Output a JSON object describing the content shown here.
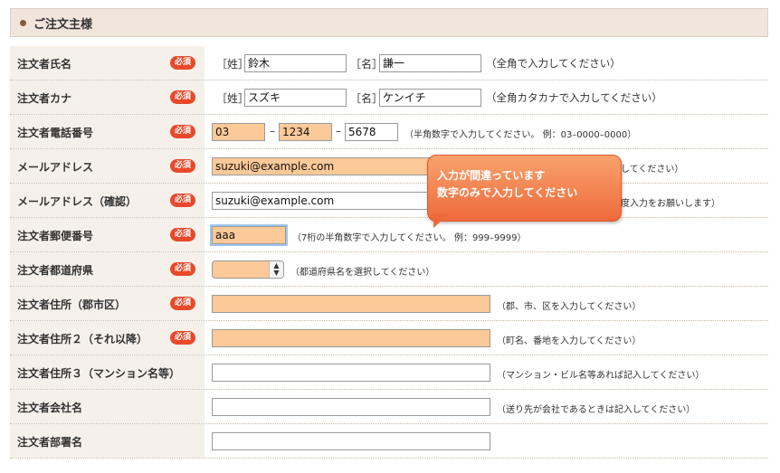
{
  "section": {
    "title": "ご注文主様"
  },
  "required_label": "必須",
  "error_tooltip": {
    "line1": "入力が間違っています",
    "line2": "数字のみで入力してください"
  },
  "rows": {
    "name": {
      "label": "注文者氏名",
      "sei_tag": "［姓］",
      "sei_value": "鈴木",
      "mei_tag": "［名］",
      "mei_value": "謙一",
      "hint": "（全角で入力してください）"
    },
    "kana": {
      "label": "注文者カナ",
      "sei_tag": "［姓］",
      "sei_value": "スズキ",
      "mei_tag": "［名］",
      "mei_value": "ケンイチ",
      "hint": "（全角カタカナで入力してください）"
    },
    "phone": {
      "label": "注文者電話番号",
      "part1": "03",
      "part2": "1234",
      "part3": "5678",
      "dash": "–",
      "hint": "（半角数字で入力してください。 例：03–0000–0000）"
    },
    "email": {
      "label": "メールアドレス",
      "value": "suzuki@example.com",
      "hint": "してください）"
    },
    "email_confirm": {
      "label": "メールアドレス（確認）",
      "value": "suzuki@example.com",
      "hint": "度入力をお願いします）"
    },
    "postal": {
      "label": "注文者郵便番号",
      "value": "aaa",
      "hint": "（7桁の半角数字で入力してください。 例：999–9999）"
    },
    "prefecture": {
      "label": "注文者都道府県",
      "selected": "",
      "hint": "（都道府県名を選択してください）"
    },
    "address1": {
      "label": "注文者住所（郡市区）",
      "value": "",
      "hint": "（郡、市、区を入力してください）"
    },
    "address2": {
      "label": "注文者住所２（それ以降）",
      "value": "",
      "hint": "（町名、番地を入力してください）"
    },
    "address3": {
      "label": "注文者住所３（マンション名等）",
      "value": "",
      "hint": "（マンション・ビル名等あれば記入してください）"
    },
    "company": {
      "label": "注文者会社名",
      "value": "",
      "hint": "（送り先が会社であるときは記入してください）"
    },
    "department": {
      "label": "注文者部署名",
      "value": ""
    }
  },
  "colors": {
    "required_badge": "#e8492b",
    "error_field": "#fcc998",
    "tooltip": "#ee6a3c",
    "label_background": "#f6f0ea"
  }
}
